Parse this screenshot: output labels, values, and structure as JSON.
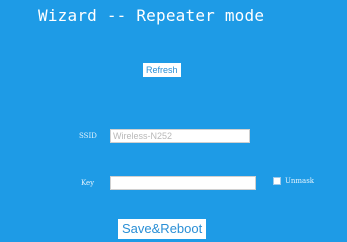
{
  "wizard": {
    "title": "Wizard -- Repeater mode"
  },
  "buttons": {
    "refresh_label": "Refresh",
    "save_reboot_label": "Save&Reboot"
  },
  "form": {
    "ssid": {
      "label": "SSID",
      "value": "",
      "placeholder": "Wireless-N252"
    },
    "key": {
      "label": "Key",
      "value": "",
      "placeholder": ""
    },
    "unmask": {
      "label": "Unmask",
      "checked": false
    }
  },
  "colors": {
    "panel_background": "#1e9be6",
    "text": "#ffffff",
    "button_text": "#2a8fd6"
  }
}
